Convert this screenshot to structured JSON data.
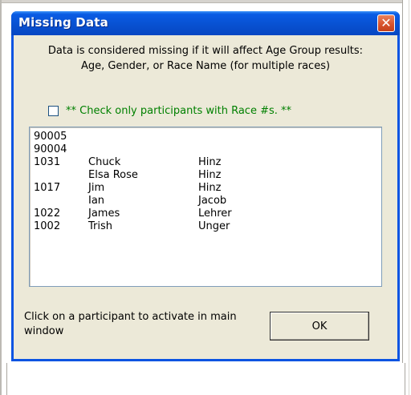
{
  "dialog": {
    "title": "Missing Data",
    "close_glyph": "✕",
    "description_line1": "Data is considered missing if it will affect Age Group results:",
    "description_line2": "Age, Gender, or Race Name (for multiple races)",
    "checkbox_label": "** Check only participants with Race #s.  **",
    "checkbox_checked": false,
    "list_rows": [
      {
        "num": "90005",
        "first": "",
        "last": ""
      },
      {
        "num": "90004",
        "first": "",
        "last": ""
      },
      {
        "num": "1031",
        "first": "Chuck",
        "last": "Hinz"
      },
      {
        "num": "",
        "first": "Elsa Rose",
        "last": "Hinz"
      },
      {
        "num": "1017",
        "first": "Jim",
        "last": "Hinz"
      },
      {
        "num": "",
        "first": "Ian",
        "last": "Jacob"
      },
      {
        "num": "1022",
        "first": "James",
        "last": "Lehrer"
      },
      {
        "num": "1002",
        "first": "Trish",
        "last": "Unger"
      }
    ],
    "hint_text": "Click on a participant to activate in main window",
    "ok_label": "OK"
  },
  "background": {
    "cutoff_text": "l"
  },
  "colors": {
    "titlebar": "#0a5ce4",
    "dialog_face": "#ece9d8",
    "checkbox_label": "#008000",
    "close_button": "#d8542e"
  },
  "icons": {
    "close": "close-icon"
  }
}
